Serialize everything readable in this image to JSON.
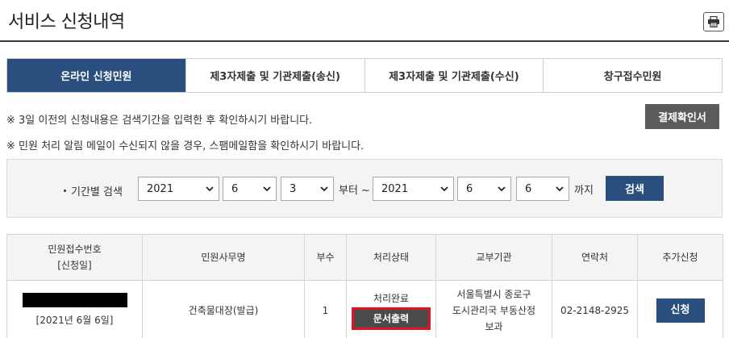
{
  "header": {
    "title": "서비스 신청내역"
  },
  "tabs": [
    {
      "label": "온라인 신청민원",
      "active": true
    },
    {
      "label": "제3자제출 및 기관제출(송신)",
      "active": false
    },
    {
      "label": "제3자제출 및 기관제출(수신)",
      "active": false
    },
    {
      "label": "창구접수민원",
      "active": false
    }
  ],
  "notices": {
    "line1": "※ 3일 이전의 신청내용은 검색기간을 입력한 후 확인하시기 바랍니다.",
    "line2": "※ 민원 처리 알림 메일이 수신되지 않을 경우, 스팸메일함을 확인하시기 바랍니다."
  },
  "receipt_button": "결제확인서",
  "search": {
    "label": "기간별 검색",
    "from_year": "2021",
    "from_month": "6",
    "from_day": "3",
    "from_text": "부터 ~",
    "to_year": "2021",
    "to_month": "6",
    "to_day": "6",
    "to_text": "까지",
    "button": "검색"
  },
  "table": {
    "headers": {
      "receipt_no": "민원접수번호",
      "apply_date": "[신청일]",
      "service_name": "민원사무명",
      "copies": "부수",
      "status": "처리상태",
      "agency": "교부기관",
      "contact": "연락처",
      "extra": "추가신청"
    },
    "rows": [
      {
        "date": "[2021년 6월 6일]",
        "service_name": "건축물대장(발급)",
        "copies": "1",
        "status": "처리완료",
        "print_button": "문서출력",
        "agency": "서울특별시 종로구 도시관리국 부동산정보과",
        "contact": "02-2148-2925",
        "apply_button": "신청"
      }
    ]
  },
  "colors": {
    "accent": "#2a4f7e",
    "highlight": "#e0141e",
    "gray_button": "#5b5b5b"
  }
}
